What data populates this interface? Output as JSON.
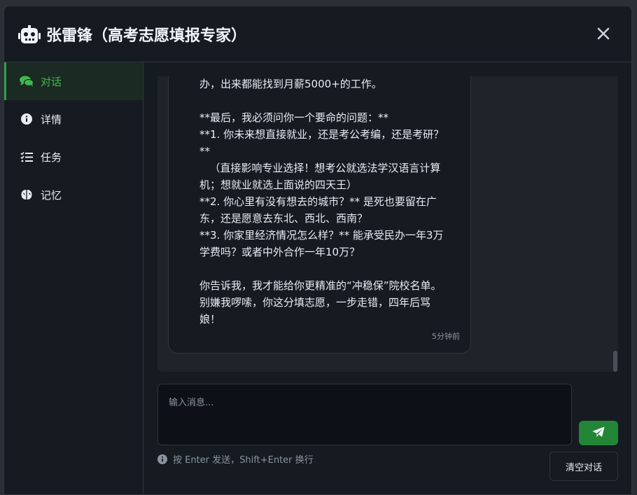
{
  "header": {
    "title": "张雷锋（高考志愿填报专家）",
    "icon": "robot-icon",
    "close_icon": "close-icon"
  },
  "sidebar": {
    "items": [
      {
        "label": "对话",
        "icon": "comments-icon",
        "active": true
      },
      {
        "label": "详情",
        "icon": "info-circle-icon",
        "active": false
      },
      {
        "label": "任务",
        "icon": "task-list-icon",
        "active": false
      },
      {
        "label": "记忆",
        "icon": "brain-icon",
        "active": false
      }
    ]
  },
  "chat": {
    "message_text": "办，出来都能找到月薪5000+的工作。\n\n**最后，我必须问你一个要命的问题：**\n**1. 你未来想直接就业，还是考公考编，还是考研？\n**\n   （直接影响专业选择！想考公就选法学汉语言计算\n机；想就业就选上面说的四天王）\n**2. 你心里有没有想去的城市？** 是死也要留在广\n东，还是愿意去东北、西北、西南？\n**3. 你家里经济情况怎么样？** 能承受民办一年3万\n学费吗？或者中外合作一年10万？\n\n你告诉我，我才能给你更精准的“冲稳保”院校名单。\n别嫌我啰嗦，你这分填志愿，一步走错，四年后骂\n娘！",
    "message_time": "5分钟前"
  },
  "composer": {
    "placeholder": "输入消息...",
    "hint": "按 Enter 发送，Shift+Enter 换行",
    "clear_label": "清空对话",
    "send_icon": "paper-plane-icon"
  },
  "colors": {
    "accent": "#2ea043",
    "send_button": "#238636",
    "background": "#161b22",
    "panel": "#1f242b"
  }
}
